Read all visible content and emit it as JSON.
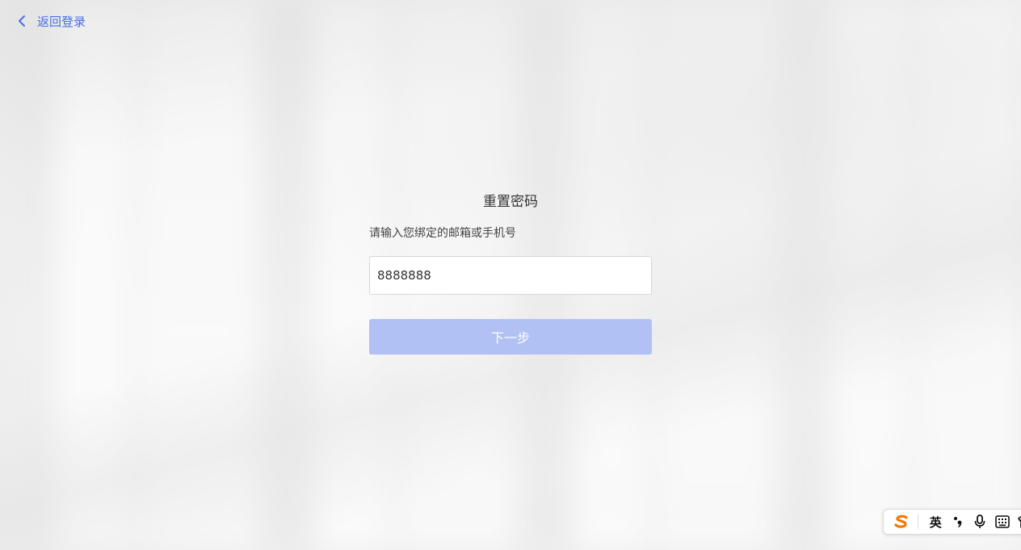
{
  "nav": {
    "back_label": "返回登录"
  },
  "reset": {
    "title": "重置密码",
    "instruction": "请输入您绑定的邮箱或手机号",
    "input_value": "8888888",
    "next_label": "下一步"
  },
  "ime": {
    "mode_label": "英"
  },
  "colors": {
    "accent": "#4a6ee0",
    "button_disabled": "#b1c1f4",
    "ime_logo": "#f5780a"
  }
}
